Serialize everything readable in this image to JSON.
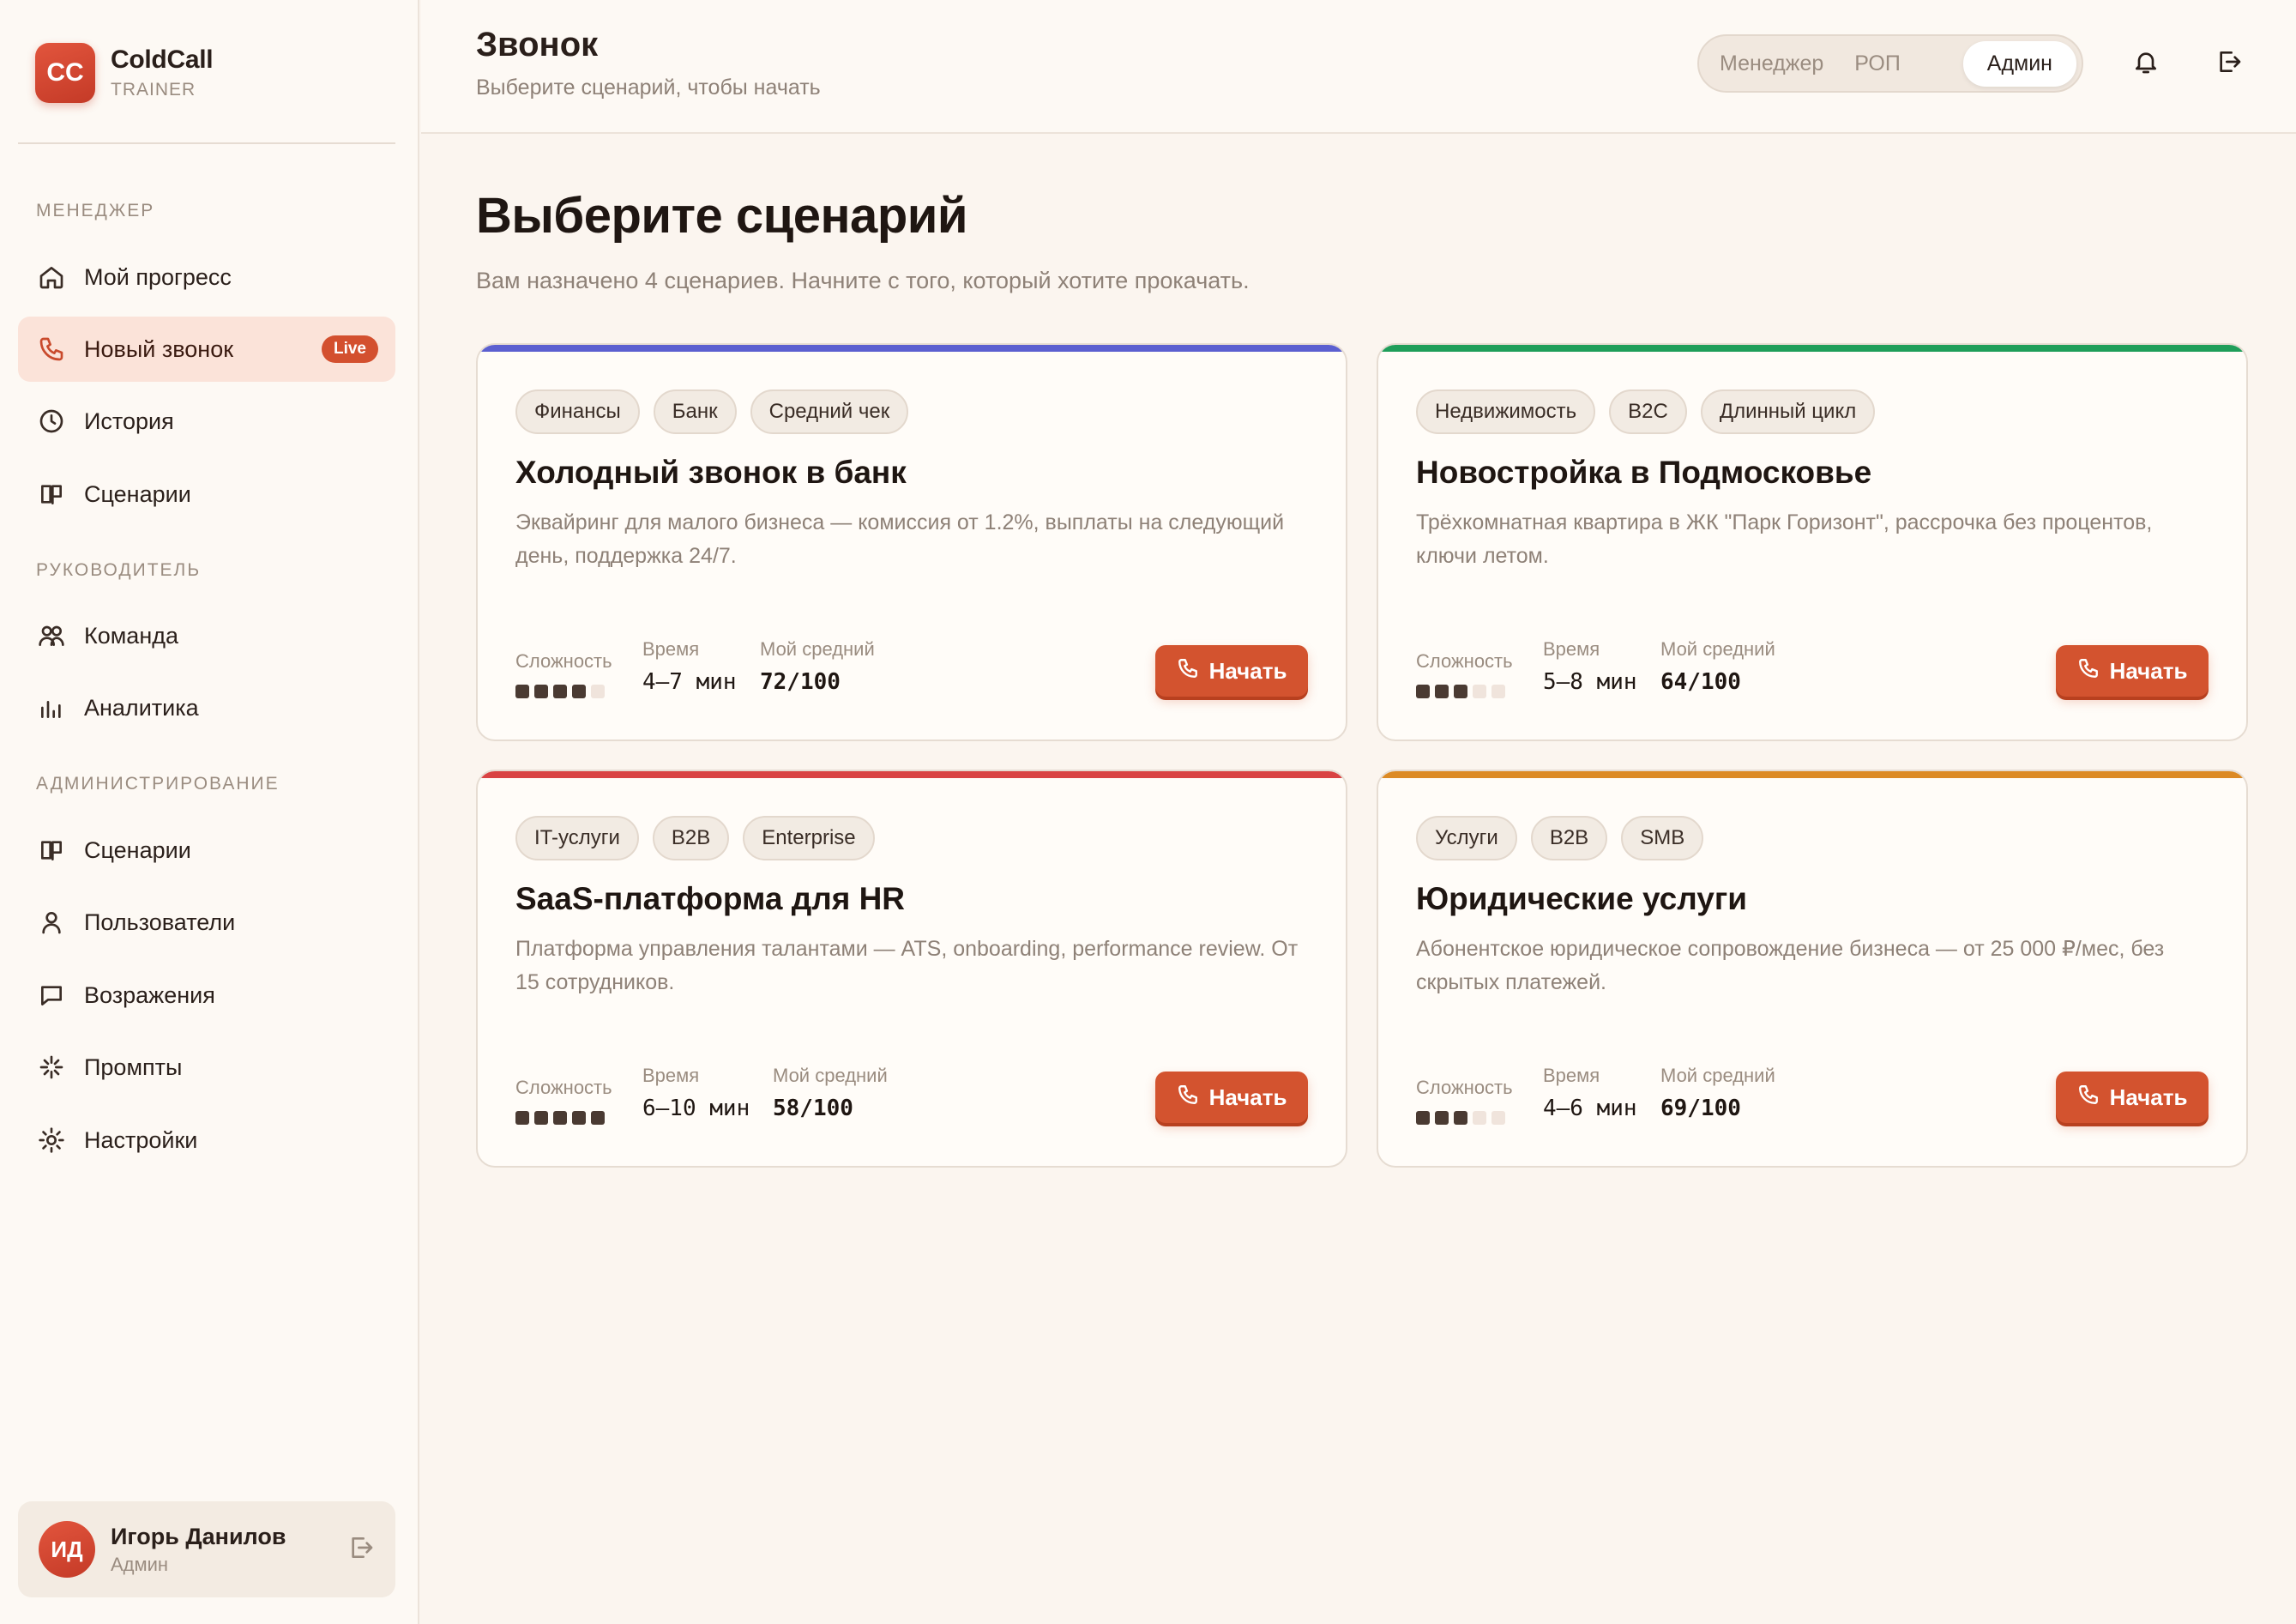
{
  "brand": {
    "logo": "CC",
    "name": "ColdCall",
    "sub": "TRAINER"
  },
  "sidebar": {
    "sections": [
      {
        "label": "МЕНЕДЖЕР"
      },
      {
        "label": "РУКОВОДИТЕЛЬ"
      },
      {
        "label": "АДМИНИСТРИРОВАНИЕ"
      }
    ],
    "items": [
      {
        "label": "Мой прогресс",
        "icon": "home-icon"
      },
      {
        "label": "Новый звонок",
        "icon": "phone-icon",
        "badge": "Live",
        "active": true
      },
      {
        "label": "История",
        "icon": "clock-icon"
      },
      {
        "label": "Сценарии",
        "icon": "book-icon"
      },
      {
        "label": "Команда",
        "icon": "users-icon"
      },
      {
        "label": "Аналитика",
        "icon": "bar-chart-icon"
      },
      {
        "label": "Сценарии",
        "icon": "book-icon"
      },
      {
        "label": "Пользователи",
        "icon": "user-icon"
      },
      {
        "label": "Возражения",
        "icon": "message-icon"
      },
      {
        "label": "Промпты",
        "icon": "sparkle-icon"
      },
      {
        "label": "Настройки",
        "icon": "gear-icon"
      }
    ]
  },
  "user": {
    "initials": "ИД",
    "name": "Игорь Данилов",
    "role": "Админ"
  },
  "header": {
    "title": "Звонок",
    "subtitle": "Выберите сценарий, чтобы начать",
    "roles": [
      "Менеджер",
      "РОП",
      "Админ"
    ],
    "active_role": "Админ"
  },
  "main": {
    "title": "Выберите сценарий",
    "subtitle": "Вам назначено 4 сценариев. Начните с того, который хотите прокачать.",
    "labels": {
      "difficulty": "Сложность",
      "time": "Время",
      "avg": "Мой средний",
      "start": "Начать"
    },
    "cards": [
      {
        "color": "#5b5fd0",
        "tags": [
          "Финансы",
          "Банк",
          "Средний чек"
        ],
        "title": "Холодный звонок в банк",
        "desc": "Эквайринг для малого бизнеса — комиссия от 1.2%, выплаты на следующий день, поддержка 24/7.",
        "difficulty": 4,
        "time": "4–7 мин",
        "avg": "72/100"
      },
      {
        "color": "#1f9e5a",
        "tags": [
          "Недвижимость",
          "B2C",
          "Длинный цикл"
        ],
        "title": "Новостройка в Подмосковье",
        "desc": "Трёхкомнатная квартира в ЖК \"Парк Горизонт\", рассрочка без процентов, ключи летом.",
        "difficulty": 3,
        "time": "5–8 мин",
        "avg": "64/100"
      },
      {
        "color": "#d94343",
        "tags": [
          "IT-услуги",
          "B2B",
          "Enterprise"
        ],
        "title": "SaaS-платформа для HR",
        "desc": "Платформа управления талантами — ATS, onboarding, performance review. От 15 сотрудников.",
        "difficulty": 5,
        "time": "6–10 мин",
        "avg": "58/100"
      },
      {
        "color": "#dc8a25",
        "tags": [
          "Услуги",
          "B2B",
          "SMB"
        ],
        "title": "Юридические услуги",
        "desc": "Абонентское юридическое сопровождение бизнеса — от 25 000 ₽/мес, без скрытых платежей.",
        "difficulty": 3,
        "time": "4–6 мин",
        "avg": "69/100"
      }
    ]
  }
}
